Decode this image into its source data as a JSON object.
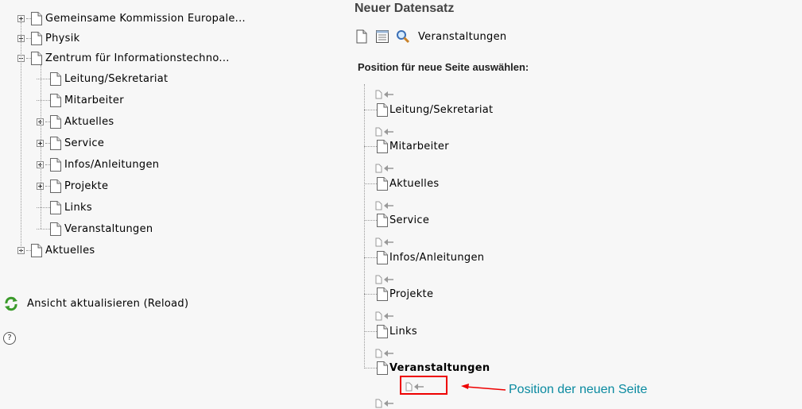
{
  "left_tree": {
    "items": [
      {
        "label": "Gemeinsame Kommission Europale...",
        "expander": "plus"
      },
      {
        "label": "Physik",
        "expander": "plus"
      },
      {
        "label": "Zentrum für Informationstechno...",
        "expander": "minus"
      },
      {
        "label": "Leitung/Sekretariat",
        "expander": "none"
      },
      {
        "label": "Mitarbeiter",
        "expander": "none"
      },
      {
        "label": "Aktuelles",
        "expander": "plus"
      },
      {
        "label": "Service",
        "expander": "plus"
      },
      {
        "label": "Infos/Anleitungen",
        "expander": "plus"
      },
      {
        "label": "Projekte",
        "expander": "plus"
      },
      {
        "label": "Links",
        "expander": "none"
      },
      {
        "label": "Veranstaltungen",
        "expander": "none"
      },
      {
        "label": "Aktuelles",
        "expander": "plus"
      }
    ],
    "reload_label": "Ansicht aktualisieren (Reload)",
    "help_glyph": "?"
  },
  "right": {
    "title": "Neuer Datensatz",
    "toolbar_label": "Veranstaltungen",
    "subheading": "Position für neue Seite auswählen:",
    "pages": [
      "Leitung/Sekretariat",
      "Mitarbeiter",
      "Aktuelles",
      "Service",
      "Infos/Anleitungen",
      "Projekte",
      "Links",
      "Veranstaltungen"
    ],
    "current_page": "Veranstaltungen"
  },
  "annotation": {
    "text": "Position der neuen Seite",
    "color": "#0a8aa0",
    "box_color": "#e00000"
  }
}
